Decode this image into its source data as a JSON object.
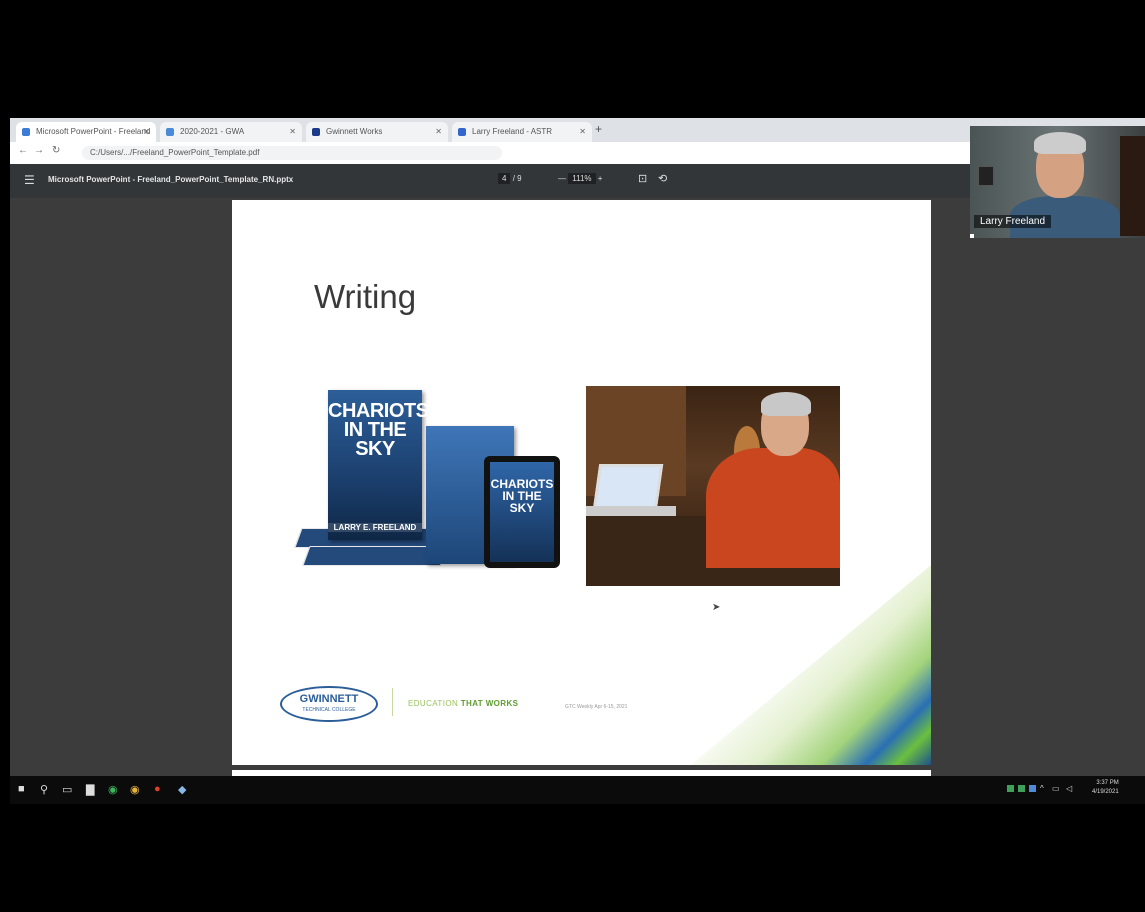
{
  "browser": {
    "tabs": [
      {
        "label": "Microsoft PowerPoint - Freeland",
        "fav": "#3d7bd8"
      },
      {
        "label": "2020-2021 - GWA",
        "fav": "#4a8ad8"
      },
      {
        "label": "Gwinnett Works",
        "fav": "#1a3b8a"
      },
      {
        "label": "Larry Freeland - ASTR",
        "fav": "#3366cc"
      }
    ],
    "url": "C:/Users/.../Freeland_PowerPoint_Template.pdf"
  },
  "pdf": {
    "title": "Microsoft PowerPoint - Freeland_PowerPoint_Template_RN.pptx",
    "page_current": "4",
    "page_total": "/ 9",
    "zoom": "111%"
  },
  "slide": {
    "title": "Writing",
    "book_title": "CHARIOTS IN THE SKY",
    "book_author": "LARRY E. FREELAND",
    "logo_text": "GWINNETT",
    "logo_sub": "TECHNICAL COLLEGE",
    "tagline_a": "EDUCATION",
    "tagline_b": "THAT WORKS",
    "footnote": "GTC Weekly Apr 6-15, 2021"
  },
  "participant": {
    "name": "Larry Freeland"
  },
  "taskbar": {
    "time": "3:37 PM",
    "date": "4/19/2021"
  },
  "colors": {
    "accent_blue": "#2a5e99",
    "accent_green": "#6bbf3f"
  }
}
